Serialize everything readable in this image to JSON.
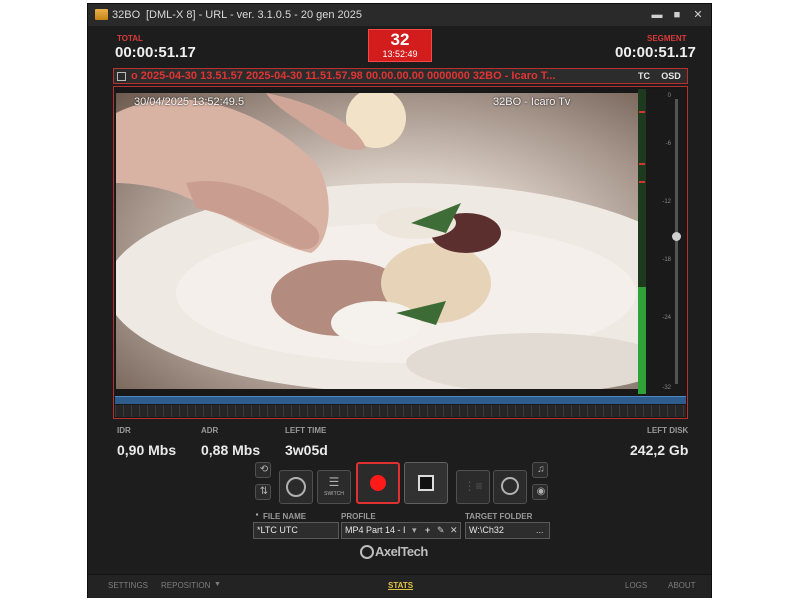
{
  "titlebar": {
    "app_name": "32BO",
    "title": "[DML-X 8] - URL - ver. 3.1.0.5 - 20 gen 2025",
    "minimize_symbol": "▬",
    "maximize_symbol": "■",
    "close_symbol": "✕"
  },
  "timers": {
    "total_label": "TOTAL",
    "total_value": "00:00:51.17",
    "segment_label": "SEGMENT",
    "segment_value": "00:00:51.17"
  },
  "channel": {
    "number": "32",
    "clock": "13:52:49"
  },
  "tc_bar": {
    "text": "o 2025-04-30  13.51.57  2025-04-30  11.51.57.98  00.00.00.00  0000000  32BO - Icaro T...",
    "tc_label": "TC",
    "osd_label": "OSD"
  },
  "preview": {
    "osd_datetime": "30/04/2025 13:52:49.5",
    "osd_channel_name": "32BO - Icaro Tv",
    "audio_level": 0.35,
    "audio_slider_level": 0.52,
    "vu_ticks": [
      "0",
      "-6",
      "-12",
      "-18",
      "-24",
      "-32"
    ]
  },
  "stats": {
    "idr_label": "IDR",
    "idr_value": "0,90 Mbs",
    "adr_label": "ADR",
    "adr_value": "0,88 Mbs",
    "left_time_label": "LEFT TIME",
    "left_time_value": "3w05d",
    "left_disk_label": "LEFT DISK",
    "left_disk_value": "242,2 Gb"
  },
  "controls": {
    "switch_label": "SWITCH"
  },
  "fields": {
    "file_name_label": "FILE NAME",
    "file_name_value": "*LTC UTC",
    "profile_label": "PROFILE",
    "profile_value": "MP4 Part 14 - I",
    "target_folder_label": "TARGET FOLDER",
    "target_folder_value": "W:\\Ch32",
    "browse_label": "..."
  },
  "brand": {
    "name": "AxelTech"
  },
  "footer": {
    "settings": "SETTINGS",
    "reposition": "REPOSITION",
    "stats": "STATS",
    "logs": "LOGS",
    "about": "ABOUT"
  }
}
